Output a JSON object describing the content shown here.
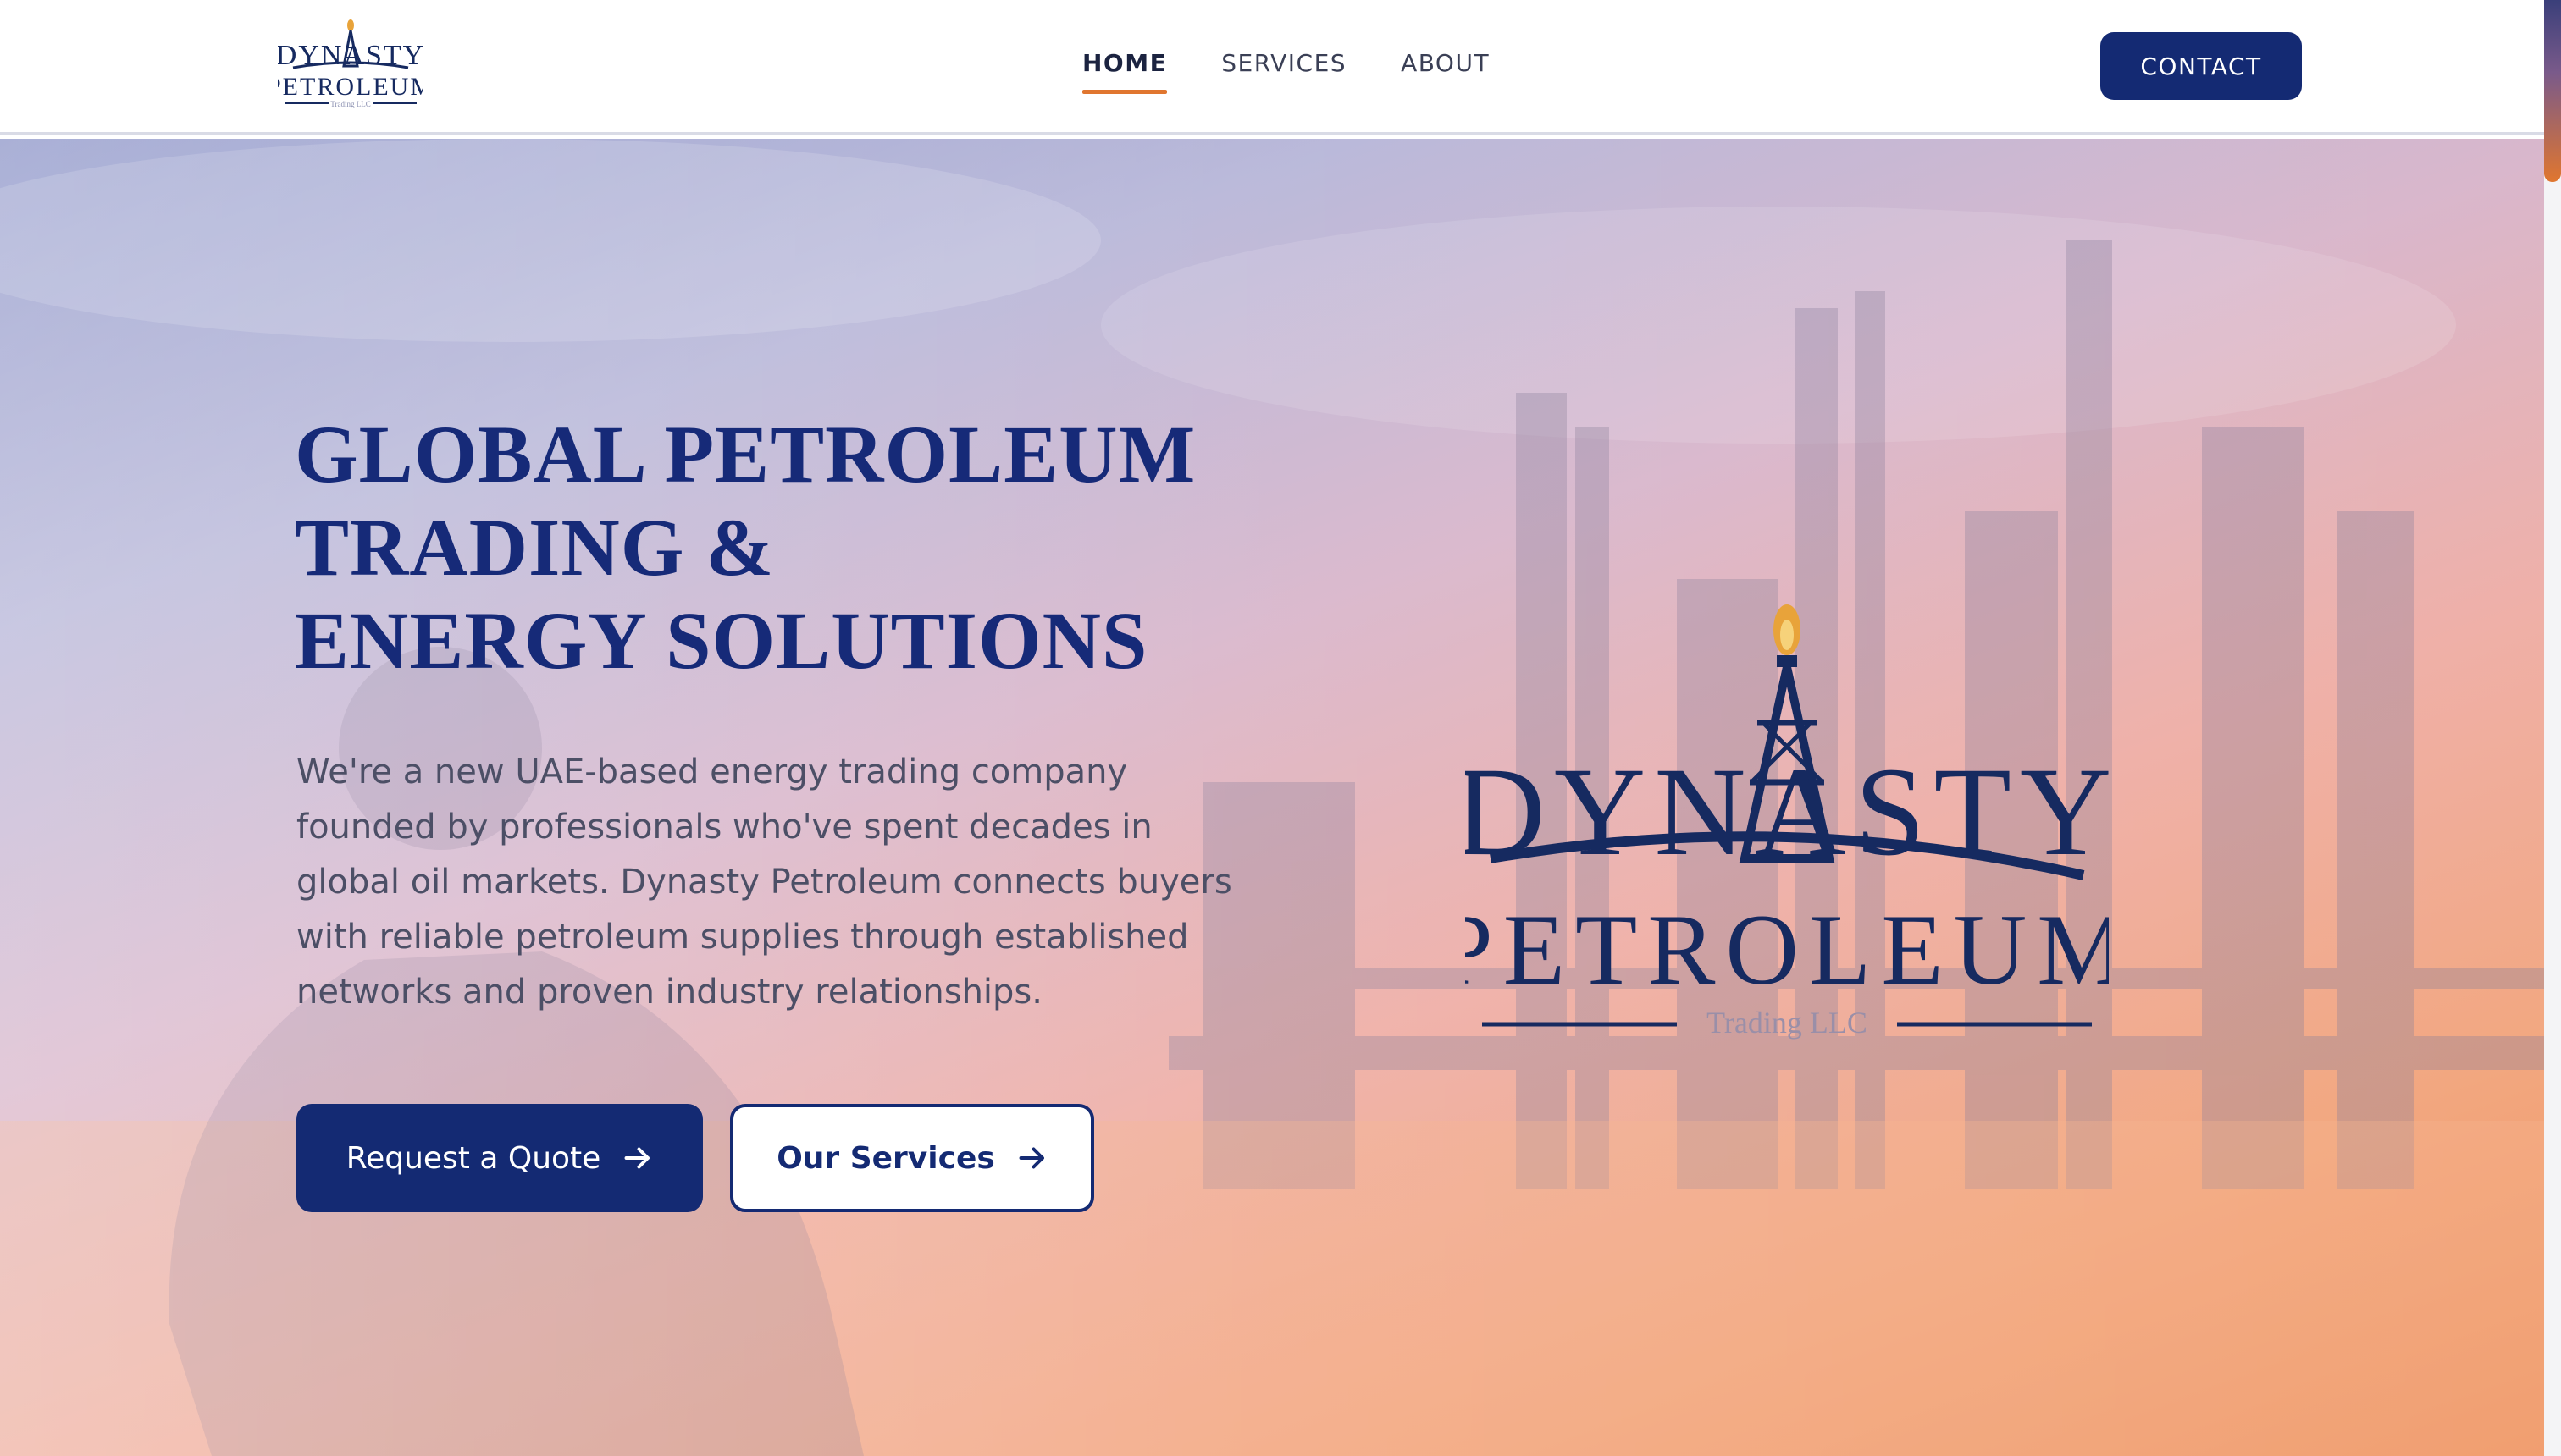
{
  "brand": {
    "name_line1": "DYNASTY",
    "name_line2": "PETROLEUM",
    "tagline": "Trading LLC"
  },
  "nav": {
    "items": [
      {
        "label": "HOME",
        "active": true
      },
      {
        "label": "SERVICES",
        "active": false
      },
      {
        "label": "ABOUT",
        "active": false
      }
    ],
    "contact_label": "CONTACT"
  },
  "hero": {
    "title_lines": [
      "GLOBAL PETROLEUM",
      "TRADING &",
      "ENERGY SOLUTIONS"
    ],
    "description": "We're a new UAE-based energy trading company founded by professionals who've spent decades in global oil markets. Dynasty Petroleum connects buyers with reliable petroleum supplies through established networks and proven industry relationships.",
    "primary_button": "Request a Quote",
    "secondary_button": "Our Services"
  },
  "icons": {
    "button_arrow": "arrow-right-icon",
    "logo_mark": "oil-derrick-icon"
  },
  "colors": {
    "brand_navy": "#142a73",
    "accent_orange": "#e0762f",
    "title_navy": "#162a78",
    "body_text": "#4c4f66"
  }
}
